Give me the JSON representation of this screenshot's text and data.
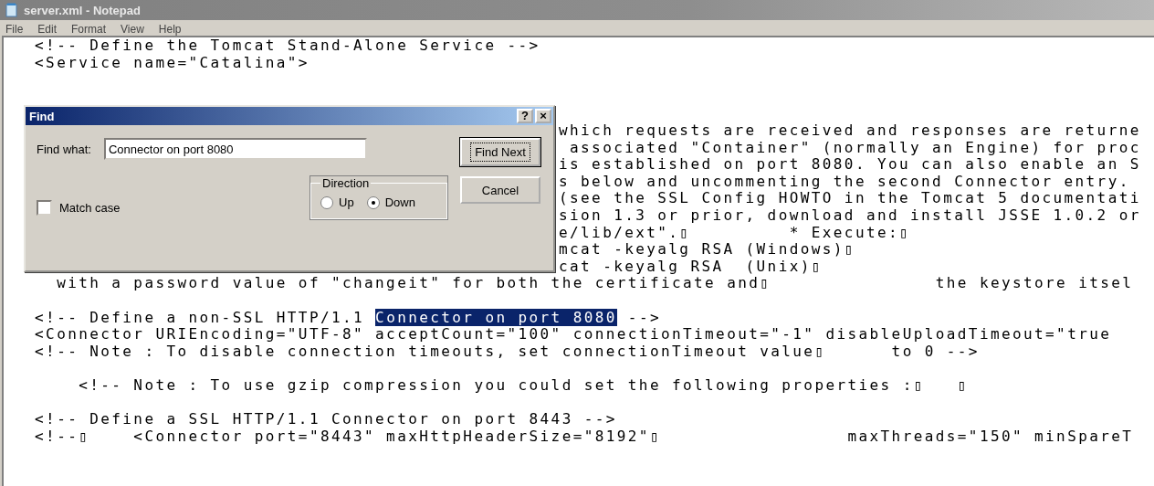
{
  "window": {
    "title": "server.xml - Notepad"
  },
  "menu": [
    "File",
    "Edit",
    "Format",
    "View",
    "Help"
  ],
  "editor": {
    "lines": [
      {
        "kind": "full",
        "text": "  <!-- Define the Tomcat Stand-Alone Service -->"
      },
      {
        "kind": "full",
        "text": "  <Service name=\"Catalina\">"
      },
      {
        "kind": "blank"
      },
      {
        "kind": "blank"
      },
      {
        "kind": "blank"
      },
      {
        "kind": "clipped",
        "text": "which requests are received and responses are returne"
      },
      {
        "kind": "clipped",
        "text": " associated \"Container\" (normally an Engine) for proc"
      },
      {
        "kind": "clipped",
        "text": "is established on port 8080. You can also enable an S"
      },
      {
        "kind": "clipped",
        "text": "s below and uncommenting the second Connector entry."
      },
      {
        "kind": "clipped",
        "text": "(see the SSL Config HOWTO in the Tomcat 5 documentati"
      },
      {
        "kind": "clipped",
        "text": "sion 1.3 or prior, download and install JSSE 1.0.2 or"
      },
      {
        "kind": "clipped",
        "text": "e/lib/ext\".▯         * Execute:▯"
      },
      {
        "kind": "clipped",
        "text": "mcat -keyalg RSA (Windows)▯"
      },
      {
        "kind": "clipped",
        "text": "cat -keyalg RSA  (Unix)▯"
      },
      {
        "kind": "full",
        "text": "    with a password value of \"changeit\" for both the certificate and▯               the keystore itsel"
      },
      {
        "kind": "blank"
      },
      {
        "kind": "segments",
        "segments": [
          {
            "text": "  <!-- Define a non-SSL HTTP/1.1 ",
            "selected": false
          },
          {
            "text": "Connector on port 8080",
            "selected": true
          },
          {
            "text": " -->",
            "selected": false
          }
        ]
      },
      {
        "kind": "full",
        "text": "  <Connector URIEncoding=\"UTF-8\" acceptCount=\"100\" connectionTimeout=\"-1\" disableUploadTimeout=\"true"
      },
      {
        "kind": "full",
        "text": "  <!-- Note : To disable connection timeouts, set connectionTimeout value▯      to 0 -->"
      },
      {
        "kind": "blank"
      },
      {
        "kind": "full",
        "text": "      <!-- Note : To use gzip compression you could set the following properties :▯   ▯"
      },
      {
        "kind": "blank"
      },
      {
        "kind": "full",
        "text": "  <!-- Define a SSL HTTP/1.1 Connector on port 8443 -->"
      },
      {
        "kind": "full",
        "text": "  <!--▯    <Connector port=\"8443\" maxHttpHeaderSize=\"8192\"▯                 maxThreads=\"150\" minSpareT"
      }
    ]
  },
  "find_dialog": {
    "title": "Find",
    "help": "?",
    "close": "×",
    "find_what_label": "Find what:",
    "find_what_value": "Connector on port 8080",
    "direction": {
      "label": "Direction",
      "options": [
        {
          "label": "Up",
          "selected": false
        },
        {
          "label": "Down",
          "selected": true
        }
      ]
    },
    "match_case": {
      "label": "Match case",
      "checked": false
    },
    "buttons": [
      {
        "label": "Find Next",
        "default": true
      },
      {
        "label": "Cancel",
        "default": false
      }
    ]
  }
}
